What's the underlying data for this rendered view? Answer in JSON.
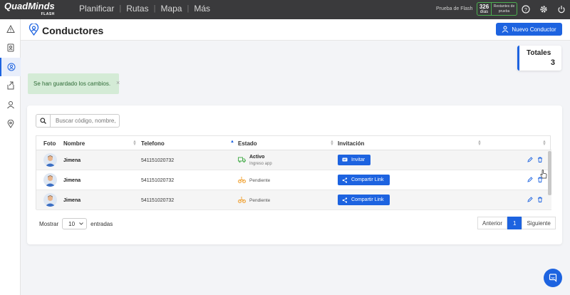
{
  "brand": {
    "name": "QuadMinds",
    "sub": "FLASH"
  },
  "nav": {
    "items": [
      "Planificar",
      "Rutas",
      "Mapa",
      "Más"
    ]
  },
  "trial": {
    "label": "Prueba de Flash",
    "days": "326",
    "days_unit": "días",
    "remaining": "Restantes de prueba"
  },
  "header": {
    "title": "Conductores",
    "new_button": "Nuevo Conductor"
  },
  "totals": {
    "label": "Totales",
    "value": "3"
  },
  "toast": {
    "message": "Se han guardado los cambios.",
    "close": "×"
  },
  "search": {
    "placeholder": "Buscar código, nombre,"
  },
  "table": {
    "headers": {
      "foto": "Foto",
      "nombre": "Nombre",
      "telefono": "Telefono",
      "estado": "Estado",
      "invitacion": "Invitación"
    },
    "rows": [
      {
        "name": "Jimena",
        "phone": "541151020732",
        "status": "Activo",
        "status_sub": "Ingreso app",
        "action": "Invitar"
      },
      {
        "name": "Jimena",
        "phone": "541151020732",
        "status": "Pendiente",
        "action": "Compartir Link"
      },
      {
        "name": "Jimena",
        "phone": "541151020732",
        "status": "Pendiente",
        "action": "Compartir Link"
      }
    ]
  },
  "footer": {
    "show_label": "Mostrar",
    "entries_value": "10",
    "entries_label": "entradas"
  },
  "pagination": {
    "prev": "Anterior",
    "current": "1",
    "next": "Siguiente"
  },
  "colors": {
    "accent": "#1d63e0",
    "topbar": "#3a3a3c",
    "toast_bg": "#d4ebd6",
    "active_green": "#4caf50",
    "pending_orange": "#f0a030"
  }
}
